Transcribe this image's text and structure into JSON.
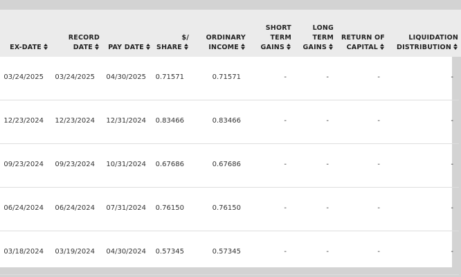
{
  "table": {
    "headers": [
      {
        "line1": "",
        "line2": "EX-DATE"
      },
      {
        "line1": "RECORD",
        "line2": "DATE"
      },
      {
        "line1": "",
        "line2": "PAY DATE"
      },
      {
        "line1": "$/",
        "line2": "SHARE"
      },
      {
        "line1": "ORDINARY",
        "line2": "INCOME"
      },
      {
        "line1": "SHORT",
        "line1b": "TERM",
        "line2": "GAINS"
      },
      {
        "line1": "LONG",
        "line1b": "TERM",
        "line2": "GAINS"
      },
      {
        "line1": "RETURN OF",
        "line2": "CAPITAL"
      },
      {
        "line1": "LIQUIDATION",
        "line2": "DISTRIBUTION"
      }
    ],
    "rows": [
      [
        "03/24/2025",
        "03/24/2025",
        "04/30/2025",
        "0.71571",
        "0.71571",
        "-",
        "-",
        "-",
        "-"
      ],
      [
        "12/23/2024",
        "12/23/2024",
        "12/31/2024",
        "0.83466",
        "0.83466",
        "-",
        "-",
        "-",
        "-"
      ],
      [
        "09/23/2024",
        "09/23/2024",
        "10/31/2024",
        "0.67686",
        "0.67686",
        "-",
        "-",
        "-",
        "-"
      ],
      [
        "06/24/2024",
        "06/24/2024",
        "07/31/2024",
        "0.76150",
        "0.76150",
        "-",
        "-",
        "-",
        "-"
      ],
      [
        "03/18/2024",
        "03/19/2024",
        "04/30/2024",
        "0.57345",
        "0.57345",
        "-",
        "-",
        "-",
        "-"
      ]
    ]
  }
}
